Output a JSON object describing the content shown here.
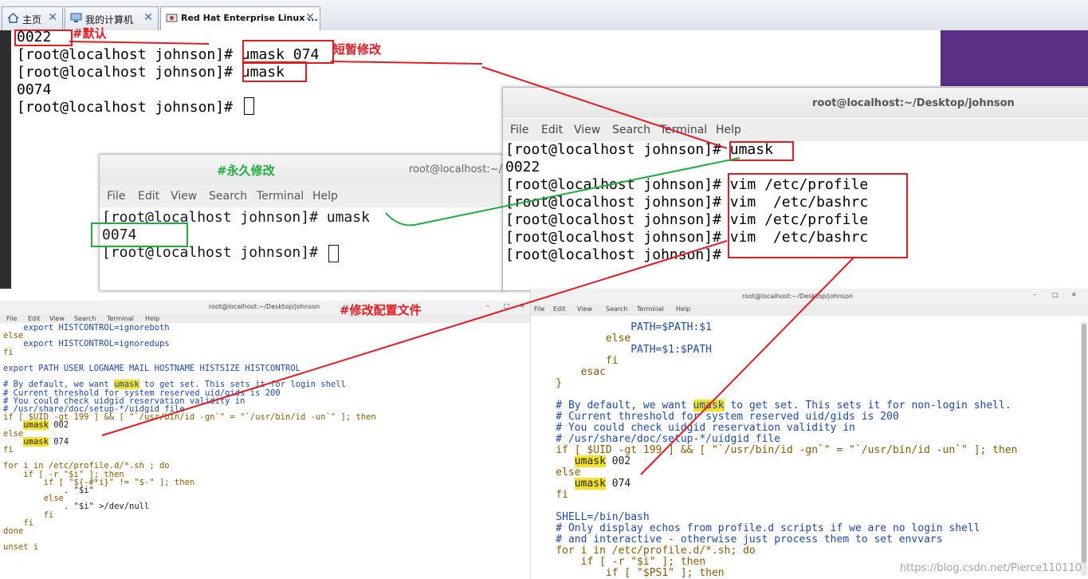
{
  "tabs": [
    {
      "label": "主页"
    },
    {
      "label": "我的计算机"
    },
    {
      "label": "Red Hat Enterprise Linux ..."
    }
  ],
  "console": {
    "lines": [
      "0022",
      "[root@localhost johnson]# umask 074",
      "[root@localhost johnson]# umask",
      "0074",
      "[root@localhost johnson]# "
    ]
  },
  "annotations": {
    "default": "#默认",
    "temp": "短暂修改",
    "permanent": "#永久修改",
    "config": "#修改配置文件"
  },
  "term_small": {
    "title": "root@localhost:~/",
    "menu": [
      "File",
      "Edit",
      "View",
      "Search",
      "Terminal",
      "Help"
    ],
    "lines": [
      "[root@localhost johnson]# umask",
      "0074",
      "[root@localhost johnson]# "
    ]
  },
  "term_big": {
    "title": "root@localhost:~/Desktop/johnson",
    "menu": [
      "File",
      "Edit",
      "View",
      "Search",
      "Terminal",
      "Help"
    ],
    "lines": [
      "[root@localhost johnson]# umask",
      "0022",
      "[root@localhost johnson]# vim /etc/profile",
      "[root@localhost johnson]# vim  /etc/bashrc",
      "[root@localhost johnson]# vim /etc/profile",
      "[root@localhost johnson]# vim  /etc/bashrc",
      "[root@localhost johnson]# "
    ]
  },
  "vim_left": {
    "title": "root@localhost:~/Desktop/johnson",
    "menu": [
      "File",
      "Edit",
      "View",
      "Search",
      "Terminal",
      "Help"
    ],
    "lines": [
      "    export HISTCONTROL=ignoreboth",
      "else",
      "    export HISTCONTROL=ignoredups",
      "fi",
      "",
      "export PATH USER LOGNAME MAIL HOSTNAME HISTSIZE HISTCONTROL",
      "",
      "# By default, we want umask to get set. This sets it for login shell",
      "# Current threshold for system reserved uid/gids is 200",
      "# You could check uidgid reservation validity in",
      "# /usr/share/doc/setup-*/uidgid file",
      "if [ $UID -gt 199 ] && [ \"`/usr/bin/id -gn`\" = \"`/usr/bin/id -un`\" ]; then",
      "    umask 002",
      "else",
      "    umask 074",
      "fi",
      "",
      "for i in /etc/profile.d/*.sh ; do",
      "    if [ -r \"$i\" ]; then",
      "        if [ \"${-#*i}\" != \"$-\" ]; then",
      "            . \"$i\"",
      "        else",
      "            . \"$i\" >/dev/null",
      "        fi",
      "    fi",
      "done",
      "",
      "unset i"
    ]
  },
  "vim_right": {
    "title": "root@localhost:~/Desktop/johnson",
    "menu": [
      "File",
      "Edit",
      "View",
      "Search",
      "Terminal",
      "Help"
    ],
    "lines": [
      "                PATH=$PATH:$1",
      "            else",
      "                PATH=$1:$PATH",
      "            fi",
      "        esac",
      "    }",
      "",
      "    # By default, we want umask to get set. This sets it for non-login shell.",
      "    # Current threshold for system reserved uid/gids is 200",
      "    # You could check uidgid reservation validity in",
      "    # /usr/share/doc/setup-*/uidgid file",
      "    if [ $UID -gt 199 ] && [ \"`/usr/bin/id -gn`\" = \"`/usr/bin/id -un`\" ]; then",
      "       umask 002",
      "    else",
      "       umask 074",
      "    fi",
      "",
      "    SHELL=/bin/bash",
      "    # Only display echos from profile.d scripts if we are no login shell",
      "    # and interactive - otherwise just process them to set envvars",
      "    for i in /etc/profile.d/*.sh; do",
      "        if [ -r \"$i\" ]; then",
      "            if [ \"$PS1\" ]; then"
    ]
  },
  "watermark": "https://blog.csdn.net/Pierce110110",
  "colors": {
    "annot_red": "#e31b23",
    "annot_green": "#1eae3f",
    "vim_blue": "#1d49a8",
    "vim_keyword": "#8a5a00",
    "highlight": "#f3e12b"
  }
}
